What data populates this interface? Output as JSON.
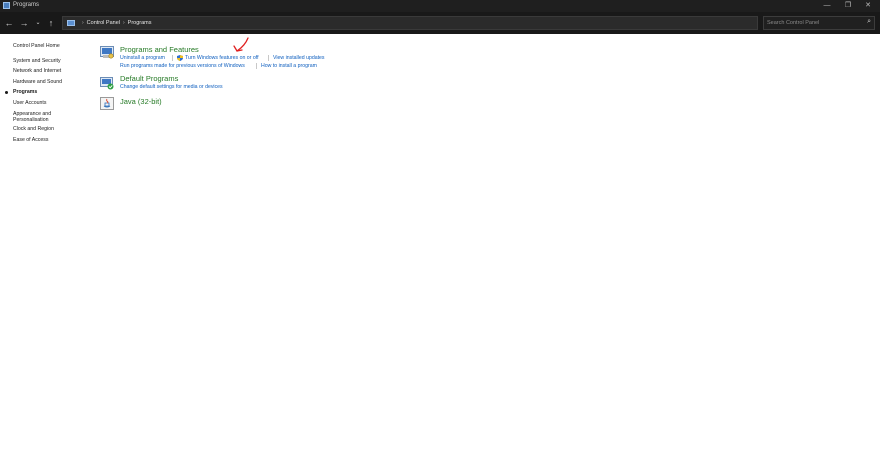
{
  "window": {
    "title": "Programs"
  },
  "controls": {
    "minimize": "—",
    "maximize": "❐",
    "close": "✕"
  },
  "nav": {
    "back_glyph": "←",
    "forward_glyph": "→",
    "recent_glyph": "⌄",
    "up_glyph": "↑"
  },
  "address": {
    "crumbs": [
      "Control Panel",
      "Programs"
    ],
    "separator": "›",
    "dropdown_glyph": "⌄",
    "refresh_glyph": "↻"
  },
  "search": {
    "placeholder": "Search Control Panel"
  },
  "sidebar": {
    "items": [
      {
        "label": "Control Panel Home",
        "active": false
      },
      {
        "label": "System and Security",
        "active": false
      },
      {
        "label": "Network and Internet",
        "active": false
      },
      {
        "label": "Hardware and Sound",
        "active": false
      },
      {
        "label": "Programs",
        "active": true
      },
      {
        "label": "User Accounts",
        "active": false
      },
      {
        "label": "Appearance and",
        "active": false
      },
      {
        "label": "Personalisation",
        "active": false
      },
      {
        "label": "Clock and Region",
        "active": false
      },
      {
        "label": "Ease of Access",
        "active": false
      }
    ]
  },
  "categories": {
    "programs_features": {
      "title": "Programs and Features",
      "icon": "programs-features-icon",
      "tasks": [
        "Uninstall a program",
        "Turn Windows features on or off",
        "View installed updates",
        "Run programs made for previous versions of Windows",
        "How to install a program"
      ]
    },
    "default_programs": {
      "title": "Default Programs",
      "icon": "default-programs-icon",
      "tasks": [
        "Change default settings for media or devices"
      ]
    },
    "java": {
      "title": "Java (32-bit)",
      "icon": "java-icon"
    }
  },
  "colors": {
    "link": "#0f5fbf",
    "category_title": "#267a26",
    "annotation": "#e02020",
    "chrome": "#1f1f1f"
  }
}
